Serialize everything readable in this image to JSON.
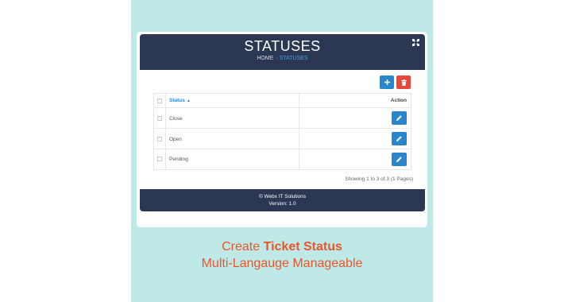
{
  "header": {
    "title": "STATUSES",
    "breadcrumb": {
      "home": "HOME",
      "separator": "›",
      "current": "STATUSES"
    },
    "expand_icon": "expand-icon"
  },
  "toolbar": {
    "add_icon": "plus-icon",
    "delete_icon": "trash-icon"
  },
  "table": {
    "columns": [
      {
        "label": "Status",
        "sort": "ascending"
      },
      {
        "label": "Action"
      }
    ],
    "rows": [
      {
        "status": "Close",
        "action_icon": "pencil-icon"
      },
      {
        "status": "Open",
        "action_icon": "pencil-icon"
      },
      {
        "status": "Pending",
        "action_icon": "pencil-icon"
      }
    ]
  },
  "pagination": {
    "summary": "Showing 1 to 3 of 3 (1 Pages)"
  },
  "footer": {
    "copyright": "© Webx IT Solutions",
    "version": "Version: 1.0"
  },
  "caption": {
    "line1_prefix": "Create",
    "line1_bold": "Ticket Status",
    "line2": "Multi-Langauge Manageable"
  },
  "colors": {
    "background": "#bfe9e6",
    "header": "#2c3753",
    "primary": "#2a86cc",
    "danger": "#e8483c",
    "caption": "#e8562a"
  }
}
